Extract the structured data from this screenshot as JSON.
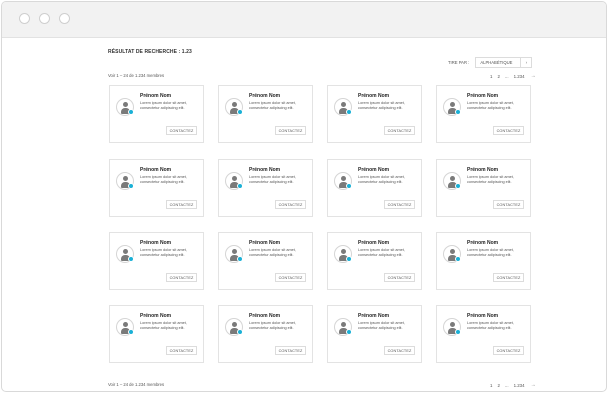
{
  "header": {
    "result_label": "RÉSULTAT DE RECHERCHE : 1.23"
  },
  "sort": {
    "label": "TIRE PAR :",
    "value": "ALPHABÉTIQUE",
    "button_icon": "chevron"
  },
  "count": {
    "top": "Voir 1 – 24 de 1.234 membres",
    "bottom": "Voir 1 – 24 de 1.234 membres"
  },
  "pagination": {
    "pages": [
      "1",
      "2"
    ],
    "ellipsis": "...",
    "last": "1.234",
    "next": "→"
  },
  "colors": {
    "status": "#1ab0d6",
    "avatar": "#7a7a7a"
  },
  "members": [
    {
      "name": "Prénom Nom",
      "desc": "Lorem ipsum dolor sit amet, consectetur adipiscing elit.",
      "button": "CONTACTEZ"
    },
    {
      "name": "Prénom Nom",
      "desc": "Lorem ipsum dolor sit amet, consectetur adipiscing elit.",
      "button": "CONTACTEZ"
    },
    {
      "name": "Prénom Nom",
      "desc": "Lorem ipsum dolor sit amet, consectetur adipiscing elit.",
      "button": "CONTACTEZ"
    },
    {
      "name": "Prénom Nom",
      "desc": "Lorem ipsum dolor sit amet, consectetur adipiscing elit.",
      "button": "CONTACTEZ"
    },
    {
      "name": "Prénom Nom",
      "desc": "Lorem ipsum dolor sit amet, consectetur adipiscing elit.",
      "button": "CONTACTEZ"
    },
    {
      "name": "Prénom Nom",
      "desc": "Lorem ipsum dolor sit amet, consectetur adipiscing elit.",
      "button": "CONTACTEZ"
    },
    {
      "name": "Prénom Nom",
      "desc": "Lorem ipsum dolor sit amet, consectetur adipiscing elit.",
      "button": "CONTACTEZ"
    },
    {
      "name": "Prénom Nom",
      "desc": "Lorem ipsum dolor sit amet, consectetur adipiscing elit.",
      "button": "CONTACTEZ"
    },
    {
      "name": "Prénom Nom",
      "desc": "Lorem ipsum dolor sit amet, consectetur adipiscing elit.",
      "button": "CONTACTEZ"
    },
    {
      "name": "Prénom Nom",
      "desc": "Lorem ipsum dolor sit amet, consectetur adipiscing elit.",
      "button": "CONTACTEZ"
    },
    {
      "name": "Prénom Nom",
      "desc": "Lorem ipsum dolor sit amet, consectetur adipiscing elit.",
      "button": "CONTACTEZ"
    },
    {
      "name": "Prénom Nom",
      "desc": "Lorem ipsum dolor sit amet, consectetur adipiscing elit.",
      "button": "CONTACTEZ"
    },
    {
      "name": "Prénom Nom",
      "desc": "Lorem ipsum dolor sit amet, consectetur adipiscing elit.",
      "button": "CONTACTEZ"
    },
    {
      "name": "Prénom Nom",
      "desc": "Lorem ipsum dolor sit amet, consectetur adipiscing elit.",
      "button": "CONTACTEZ"
    },
    {
      "name": "Prénom Nom",
      "desc": "Lorem ipsum dolor sit amet, consectetur adipiscing elit.",
      "button": "CONTACTEZ"
    },
    {
      "name": "Prénom Nom",
      "desc": "Lorem ipsum dolor sit amet, consectetur adipiscing elit.",
      "button": "CONTACTEZ"
    }
  ]
}
